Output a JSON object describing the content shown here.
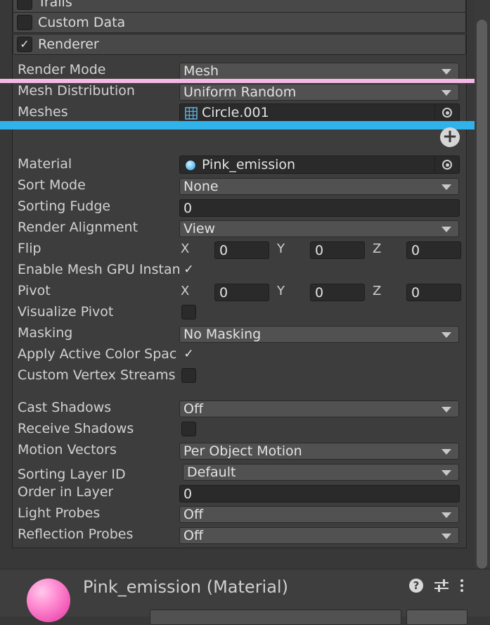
{
  "modules": {
    "trails": {
      "label": "Trails",
      "checked": false
    },
    "custom_data": {
      "label": "Custom Data",
      "checked": false
    },
    "renderer": {
      "label": "Renderer",
      "checked": true,
      "check_glyph": "✓"
    }
  },
  "renderer": {
    "render_mode": {
      "label": "Render Mode",
      "value": "Mesh"
    },
    "mesh_distribution": {
      "label": "Mesh Distribution",
      "value": "Uniform Random"
    },
    "meshes": {
      "label": "Meshes",
      "value": "Circle.001",
      "icon": "mesh-grid-icon"
    },
    "material": {
      "label": "Material",
      "value": "Pink_emission",
      "icon": "material-sphere-icon"
    },
    "sort_mode": {
      "label": "Sort Mode",
      "value": "None"
    },
    "sorting_fudge": {
      "label": "Sorting Fudge",
      "value": "0"
    },
    "render_alignment": {
      "label": "Render Alignment",
      "value": "View"
    },
    "flip": {
      "label": "Flip",
      "x_label": "X",
      "x": "0",
      "y_label": "Y",
      "y": "0",
      "z_label": "Z",
      "z": "0"
    },
    "enable_mesh_gpu_instancing": {
      "label": "Enable Mesh GPU Instan",
      "checked": true,
      "check_glyph": "✓"
    },
    "pivot": {
      "label": "Pivot",
      "x_label": "X",
      "x": "0",
      "y_label": "Y",
      "y": "0",
      "z_label": "Z",
      "z": "0"
    },
    "visualize_pivot": {
      "label": "Visualize Pivot",
      "checked": false
    },
    "masking": {
      "label": "Masking",
      "value": "No Masking"
    },
    "apply_active_color_space": {
      "label": "Apply Active Color Spac",
      "checked": true,
      "check_glyph": "✓"
    },
    "custom_vertex_streams": {
      "label": "Custom Vertex Streams",
      "checked": false
    },
    "cast_shadows": {
      "label": "Cast Shadows",
      "value": "Off"
    },
    "receive_shadows": {
      "label": "Receive Shadows",
      "checked": false
    },
    "motion_vectors": {
      "label": "Motion Vectors",
      "value": "Per Object Motion"
    },
    "sorting_layer_id": {
      "label": "Sorting Layer ID",
      "value": "Default"
    },
    "order_in_layer": {
      "label": "Order in Layer",
      "value": "0"
    },
    "light_probes": {
      "label": "Light Probes",
      "value": "Off"
    },
    "reflection_probes": {
      "label": "Reflection Probes",
      "value": "Off"
    }
  },
  "add_button": {
    "glyph": "+"
  },
  "material_footer": {
    "title": "Pink_emission (Material)",
    "help_glyph": "?"
  },
  "colors": {
    "pink_line": "#f5b8e6",
    "blue_line": "#2fb3ea",
    "material_pink": "#ff8fd4"
  }
}
